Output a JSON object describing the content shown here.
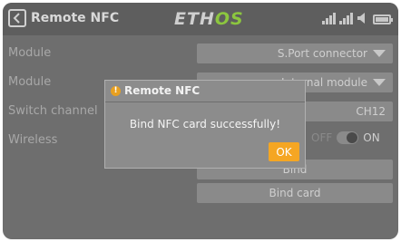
{
  "header": {
    "title": "Remote NFC",
    "brand_left": "ETH",
    "brand_right": "OS"
  },
  "rows": [
    {
      "label": "Module",
      "value": "S.Port connector"
    },
    {
      "label": "Module",
      "value": "Internal module"
    },
    {
      "label": "Switch channel",
      "value": "CH12"
    },
    {
      "label": "Wireless",
      "off_label": "OFF",
      "on_label": "ON"
    }
  ],
  "buttons": {
    "bind": "Bind",
    "bind_card": "Bind card"
  },
  "dialog": {
    "title": "Remote NFC",
    "message": "Bind NFC card successfully!",
    "ok_label": "OK"
  },
  "colors": {
    "accent": "#f5a623",
    "brand_green": "#8cc63f"
  },
  "icons": {
    "back": "back-icon",
    "signal": "signal-bars-icon",
    "speaker": "speaker-icon",
    "battery": "battery-icon",
    "warning": "warning-icon"
  }
}
